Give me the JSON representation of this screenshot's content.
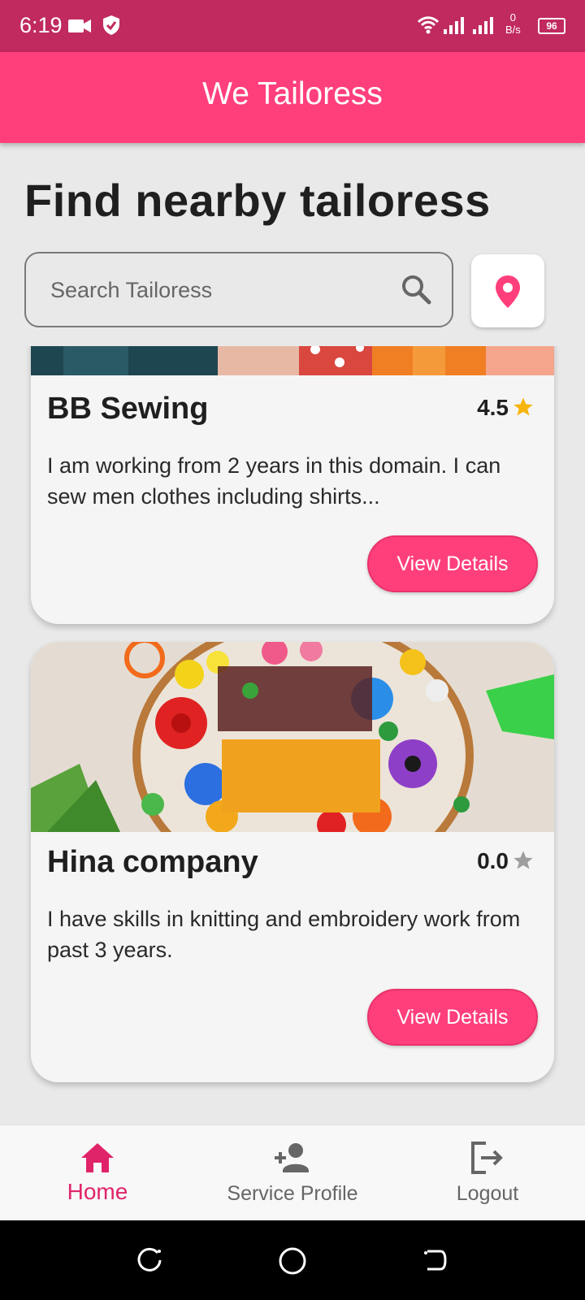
{
  "status_bar": {
    "time": "6:19",
    "net_speed_value": "0",
    "net_speed_unit": "B/s",
    "battery": "96"
  },
  "app_bar": {
    "title": "We Tailoress"
  },
  "main": {
    "headline": "Find nearby tailoress",
    "search": {
      "placeholder": "Search Tailoress",
      "value": ""
    }
  },
  "tailors": [
    {
      "name": "BB Sewing",
      "rating": "4.5",
      "description": "I am working from 2 years in this domain. I can sew men clothes including shirts...",
      "button": "View Details"
    },
    {
      "name": "Hina company",
      "rating": "0.0",
      "description": "I have skills in knitting and embroidery work from past 3 years.",
      "button": "View Details"
    }
  ],
  "bottom_nav": [
    {
      "label": "Home",
      "icon": "home-icon",
      "active": true
    },
    {
      "label": "Service Profile",
      "icon": "person-add-icon",
      "active": false
    },
    {
      "label": "Logout",
      "icon": "logout-icon",
      "active": false
    }
  ],
  "colors": {
    "accent": "#ff3f7c",
    "status_bar": "#c02a5f",
    "star_active": "#f6b50e",
    "star_inactive": "#9e9e9e"
  }
}
